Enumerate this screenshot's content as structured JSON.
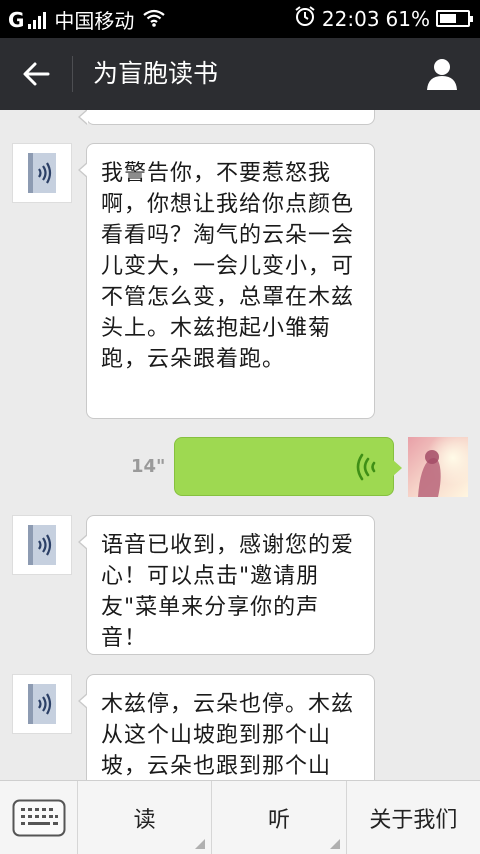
{
  "status_bar": {
    "network": "G",
    "carrier": "中国移动",
    "time": "22:03",
    "battery": "61%",
    "battery_level": 0.61
  },
  "header": {
    "title": "为盲胞读书",
    "back_icon": "back-arrow-icon",
    "profile_icon": "person-icon"
  },
  "messages": [
    {
      "type": "text",
      "side": "left",
      "text": "我警告你，不要惹怒我啊，你想让我给你点颜色看看吗？淘气的云朵一会儿变大，一会儿变小，可不管怎么变，总罩在木兹头上。木兹抱起小雏菊跑，云朵跟着跑。"
    },
    {
      "type": "voice",
      "side": "right",
      "duration": "14\""
    },
    {
      "type": "text",
      "side": "left",
      "text": "语音已收到，感谢您的爱心！可以点击\"邀请朋友\"菜单来分享你的声音！"
    },
    {
      "type": "text",
      "side": "left",
      "text": "木兹停，云朵也停。木兹从这个山坡跑到那个山坡，云朵也跟到那个山坡。木兹气坏了，他"
    }
  ],
  "bottom_menu": {
    "keyboard_icon": "keyboard-icon",
    "items": [
      "读",
      "听",
      "关于我们"
    ]
  },
  "colors": {
    "header_bg": "#2c2d31",
    "chat_bg": "#ebebeb",
    "voice_bubble": "#9ed951",
    "voice_icon": "#3f8f16"
  }
}
